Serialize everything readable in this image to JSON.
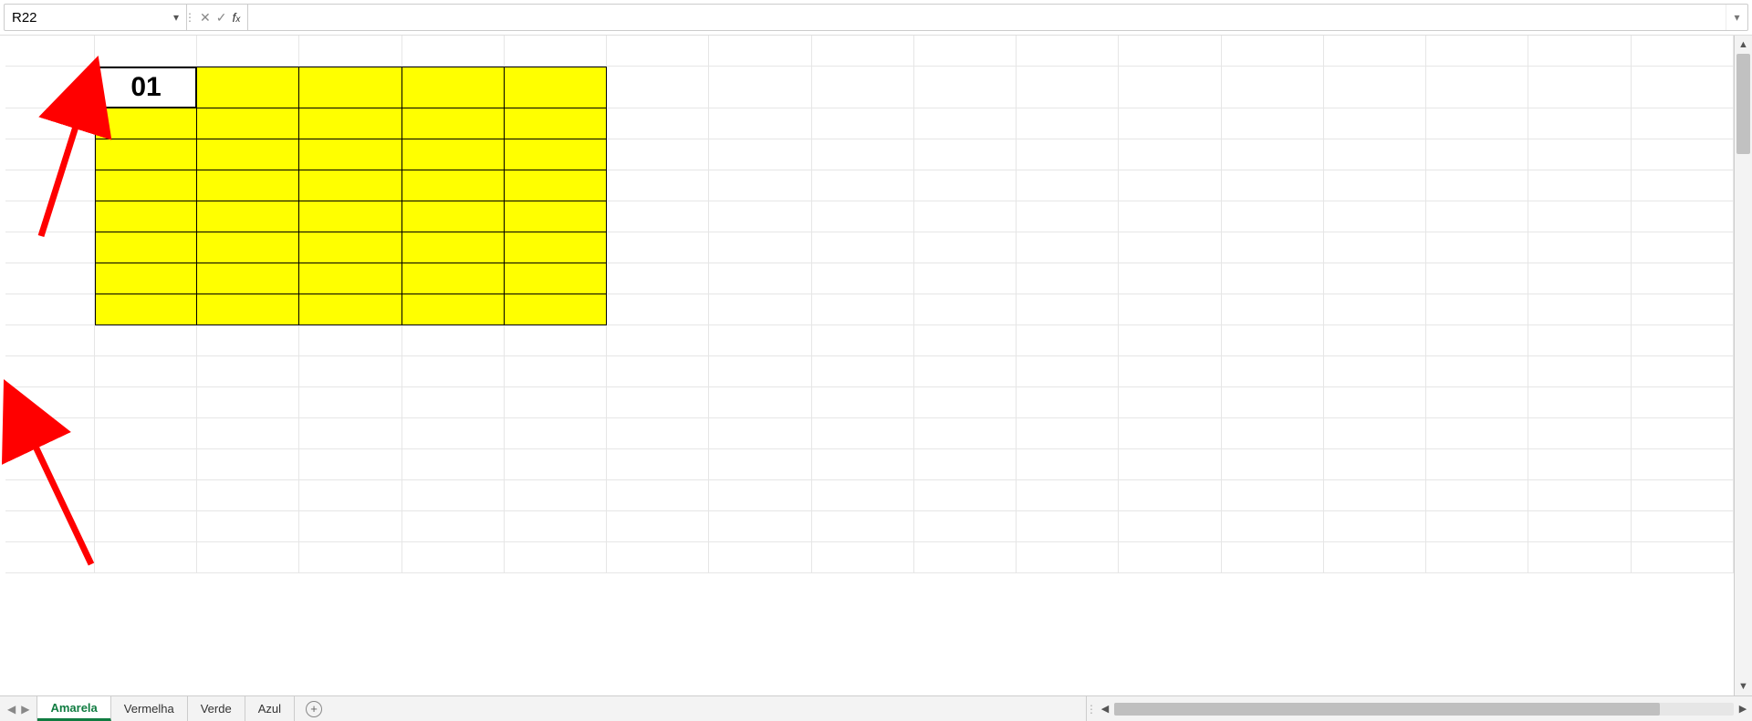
{
  "formula_bar": {
    "name_box": "R22",
    "formula": ""
  },
  "grid": {
    "heading_cell": "01",
    "block_rows": 8,
    "block_cols": 5,
    "block_start_row": 1,
    "block_start_col": 1,
    "total_rows": 17,
    "total_cols": 17,
    "fill_color": "#ffff00"
  },
  "tabs": {
    "items": [
      {
        "label": "Amarela",
        "active": true
      },
      {
        "label": "Vermelha",
        "active": false
      },
      {
        "label": "Verde",
        "active": false
      },
      {
        "label": "Azul",
        "active": false
      }
    ]
  }
}
